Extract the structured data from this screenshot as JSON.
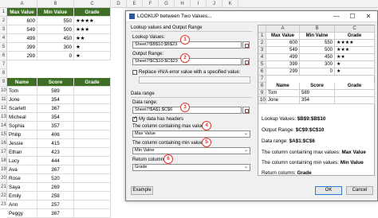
{
  "sheet": {
    "columns": [
      "A",
      "B",
      "C",
      "D",
      "E",
      "F",
      "G",
      "H",
      "I",
      "J",
      "K"
    ],
    "rows": [
      "1",
      "2",
      "3",
      "4",
      "5",
      "6",
      "7",
      "8",
      "9",
      "10",
      "11",
      "12",
      "13",
      "14",
      "15",
      "16",
      "17",
      "18",
      "19",
      "20",
      "21",
      "22",
      "23"
    ],
    "grade_table": {
      "headers": [
        "Max Value",
        "Min Value",
        "Grade"
      ],
      "rows": [
        [
          "600",
          "550",
          "★★★★"
        ],
        [
          "549",
          "500",
          "★★★"
        ],
        [
          "499",
          "450",
          "★★"
        ],
        [
          "399",
          "300",
          "★"
        ],
        [
          "299",
          "0",
          "★"
        ]
      ]
    },
    "score_table": {
      "headers": [
        "Name",
        "Score",
        "Grade"
      ],
      "rows": [
        [
          "Tom",
          "589"
        ],
        [
          "Jone",
          "354"
        ],
        [
          "Scarlett",
          "367"
        ],
        [
          "Micheal",
          "354"
        ],
        [
          "Sophia",
          "357"
        ],
        [
          "Philip",
          "406"
        ],
        [
          "Jessie",
          "415"
        ],
        [
          "Ethan",
          "423"
        ],
        [
          "Lucy",
          "444"
        ],
        [
          "Ava",
          "367"
        ],
        [
          "Rose",
          "520"
        ],
        [
          "Saya",
          "269"
        ],
        [
          "Emily",
          "258"
        ],
        [
          "Ann",
          "257"
        ],
        [
          "Peggy",
          "367"
        ]
      ]
    }
  },
  "dialog": {
    "title": "LOOKUP between Two Values...",
    "minimize": "—",
    "maximize": "☐",
    "close": "✕",
    "section1": "Lookup values and Output Range",
    "lookup_label": "Lookup Values:",
    "lookup_value": "Sheet7!$B$10:$B$23",
    "output_label": "Output Range:",
    "output_value": "Sheet7!$C$10:$C$23",
    "replace_label": "Replace #N/A error value with a specified value:",
    "section2": "Data range",
    "data_range_label": "Data range:",
    "data_range_value": "Sheet7!$A$1:$C$6",
    "headers_label": "My data has headers",
    "max_label": "The column containing max values:",
    "max_value": "Max Value",
    "min_label": "The column containing min values:",
    "min_value": "Min Valne",
    "return_label": "Return column:",
    "return_value": "Grade",
    "badges": [
      "1",
      "2",
      "3",
      "4",
      "5",
      "6"
    ],
    "example": "Example",
    "ok": "OK",
    "cancel": "Cancel"
  },
  "preview": {
    "columns": [
      "A",
      "B",
      "C"
    ],
    "rows": [
      "1",
      "2",
      "3",
      "4",
      "5",
      "6",
      "7",
      "8",
      "9",
      "10"
    ],
    "table1_headers": [
      "Max Value",
      "Min Valne",
      "Grade"
    ],
    "table1_rows": [
      [
        "600",
        "550",
        "★★★★"
      ],
      [
        "549",
        "500",
        "★★★"
      ],
      [
        "499",
        "450",
        "★★"
      ],
      [
        "399",
        "300",
        "★"
      ],
      [
        "299",
        "0",
        "★"
      ]
    ],
    "table2_headers": [
      "Name",
      "Score",
      "Grade"
    ],
    "table2_rows": [
      [
        "Tom",
        "589"
      ],
      [
        "Jone",
        "354"
      ]
    ],
    "lookup_prefix": "Lookup Values:",
    "lookup_ref": "$B$9:$B$10",
    "output_prefix": "Output Range:",
    "output_ref": "$C$9:$C$10",
    "data_prefix": "Data range:",
    "data_ref": "$A$1:$C$6",
    "max_prefix": "The column containing max values:",
    "max_ref": "Max Value",
    "min_prefix": "The column containing min values:",
    "min_ref": "Min Value",
    "return_prefix": "Return column:",
    "return_ref": "Grade"
  }
}
